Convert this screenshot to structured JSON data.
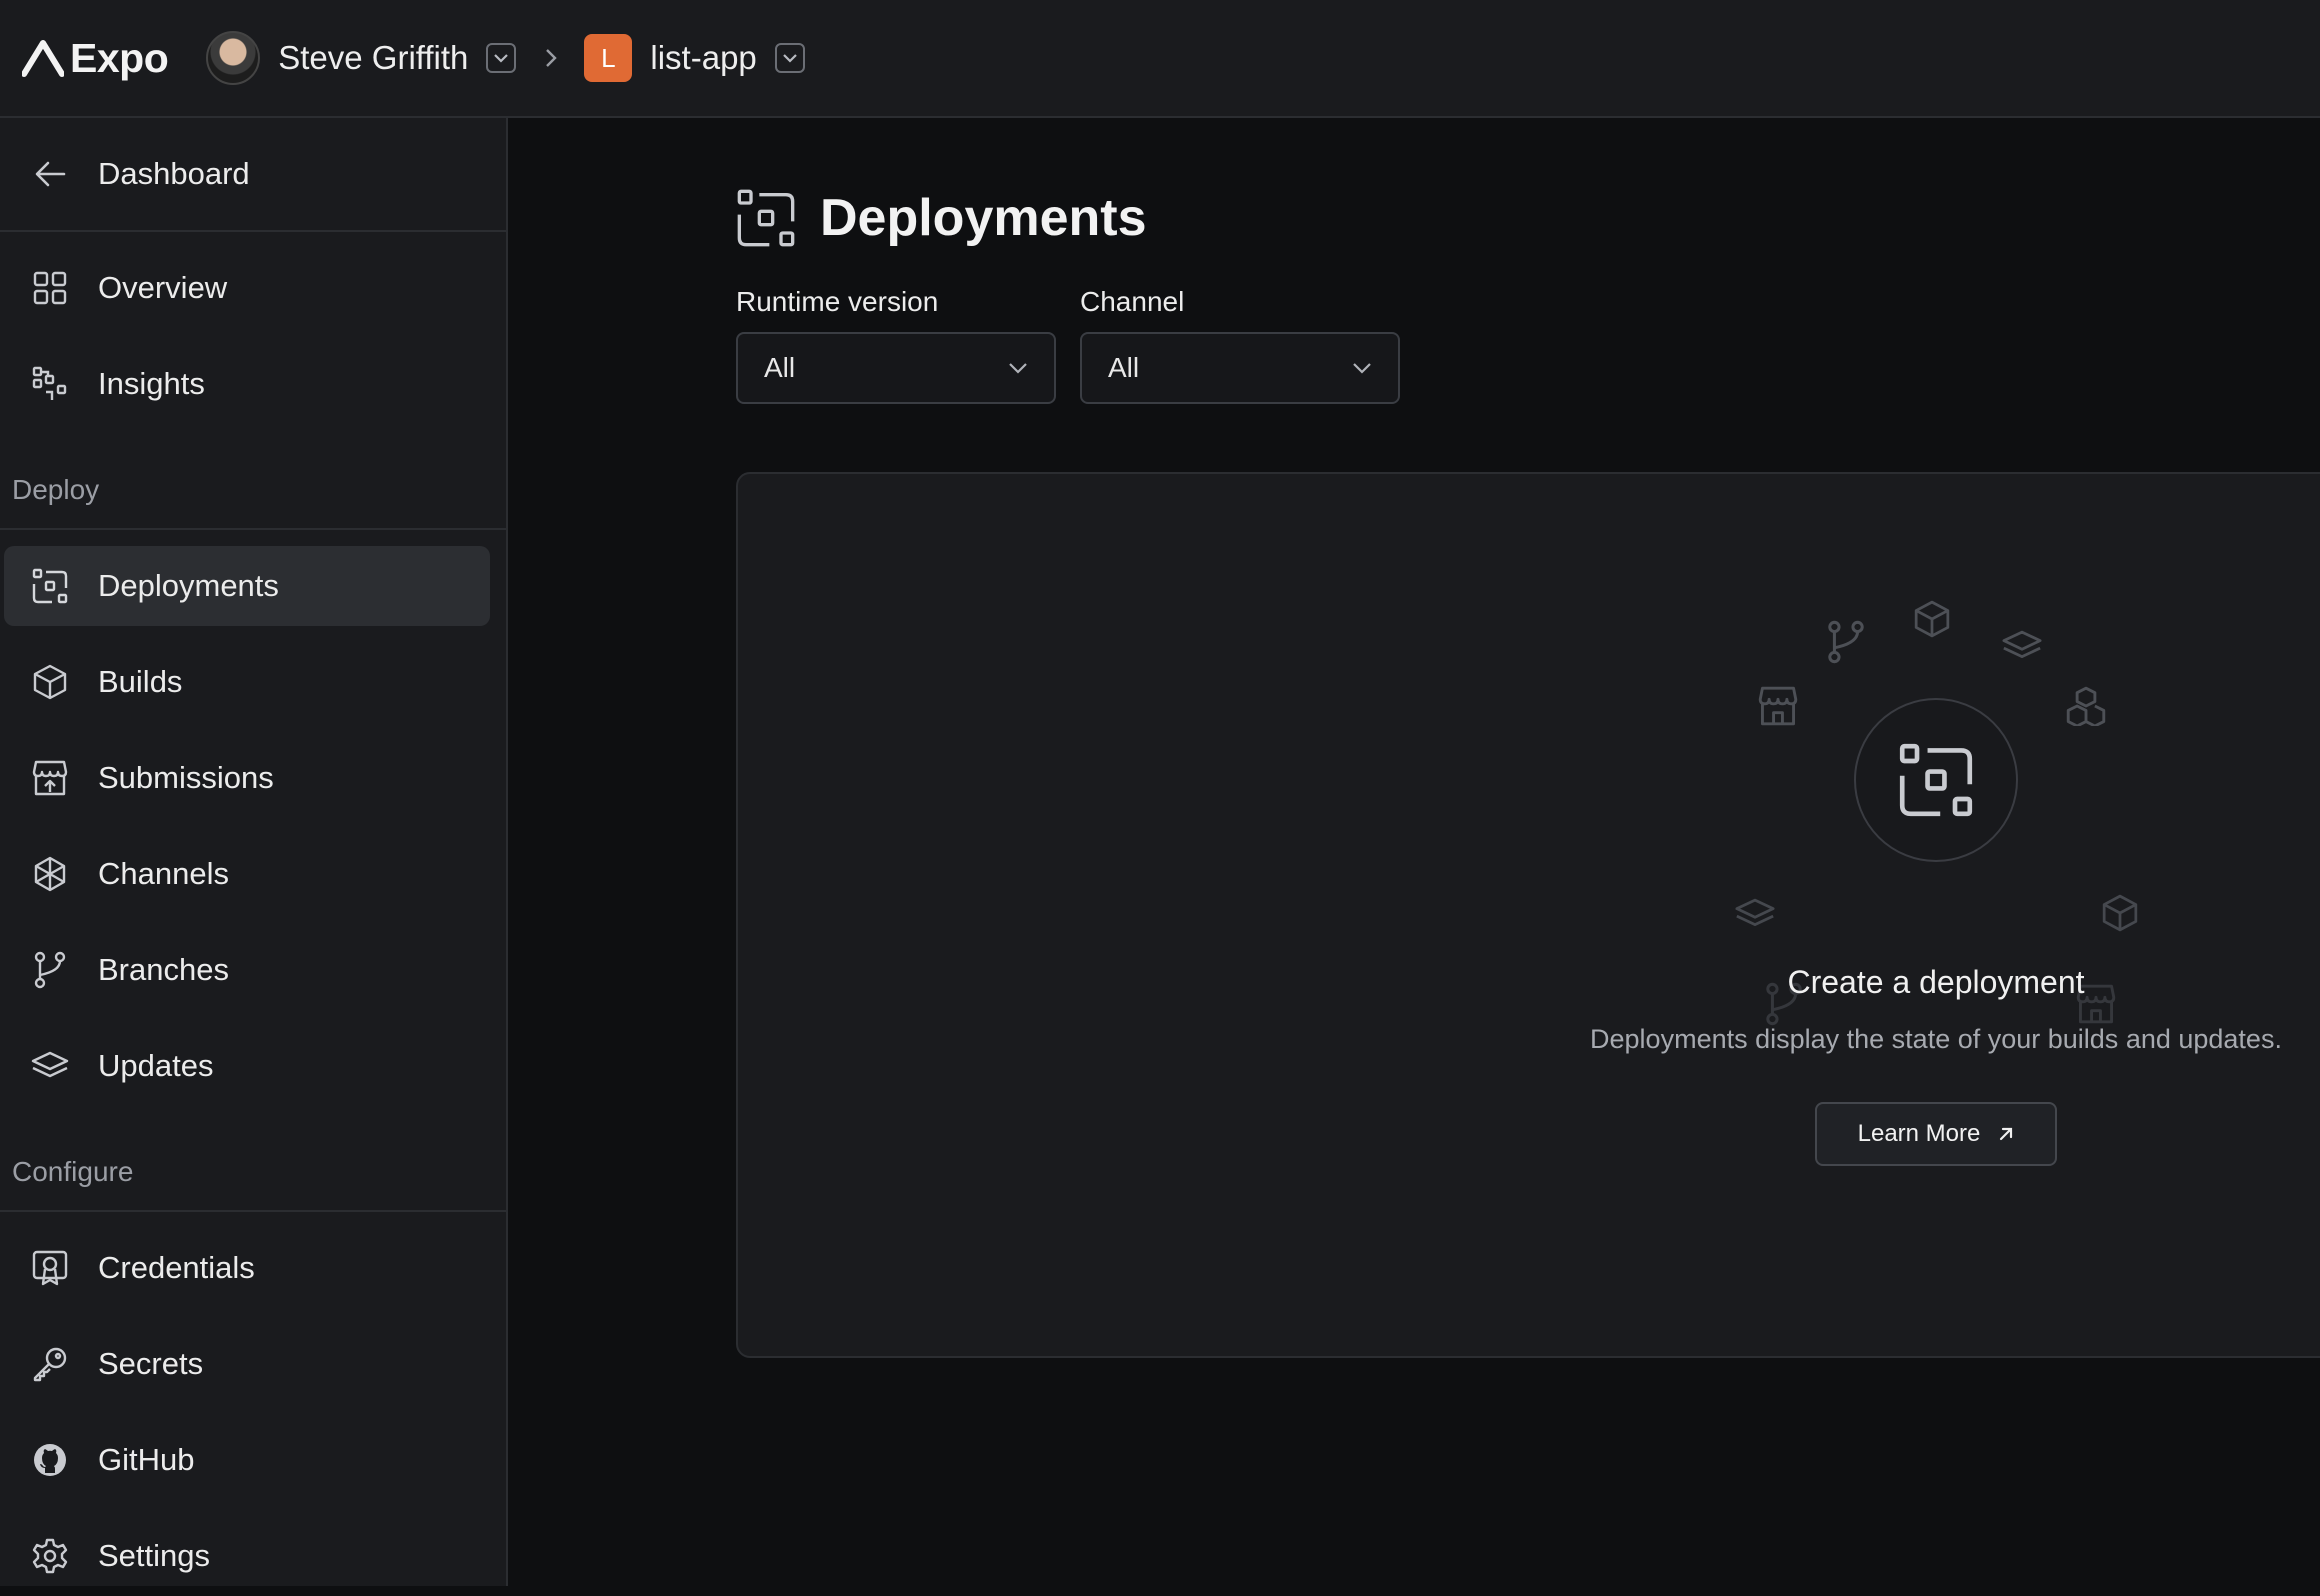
{
  "header": {
    "logo_text": "Expo",
    "account_name": "Steve Griffith",
    "app_badge_letter": "L",
    "app_name": "list-app"
  },
  "sidebar": {
    "back_label": "Dashboard",
    "items_top": [
      {
        "label": "Overview",
        "icon": "grid-icon"
      },
      {
        "label": "Insights",
        "icon": "insights-icon"
      }
    ],
    "deploy_section": "Deploy",
    "deploy_items": [
      {
        "label": "Deployments",
        "icon": "deployments-icon",
        "active": true
      },
      {
        "label": "Builds",
        "icon": "cube-icon"
      },
      {
        "label": "Submissions",
        "icon": "store-upload-icon"
      },
      {
        "label": "Channels",
        "icon": "channels-icon"
      },
      {
        "label": "Branches",
        "icon": "branch-icon"
      },
      {
        "label": "Updates",
        "icon": "layers-icon"
      }
    ],
    "configure_section": "Configure",
    "configure_items": [
      {
        "label": "Credentials",
        "icon": "certificate-icon"
      },
      {
        "label": "Secrets",
        "icon": "key-icon"
      },
      {
        "label": "GitHub",
        "icon": "github-icon"
      },
      {
        "label": "Settings",
        "icon": "gear-icon"
      }
    ]
  },
  "main": {
    "title": "Deployments",
    "filters": {
      "runtime_label": "Runtime version",
      "runtime_value": "All",
      "channel_label": "Channel",
      "channel_value": "All"
    },
    "empty_state": {
      "title": "Create a deployment",
      "description": "Deployments display the state of your builds and updates.",
      "button_label": "Learn More"
    }
  },
  "colors": {
    "background": "#0e0f11",
    "surface": "#1a1b1e",
    "accent_badge": "#e06a34",
    "active_item": "#2c2e32"
  }
}
